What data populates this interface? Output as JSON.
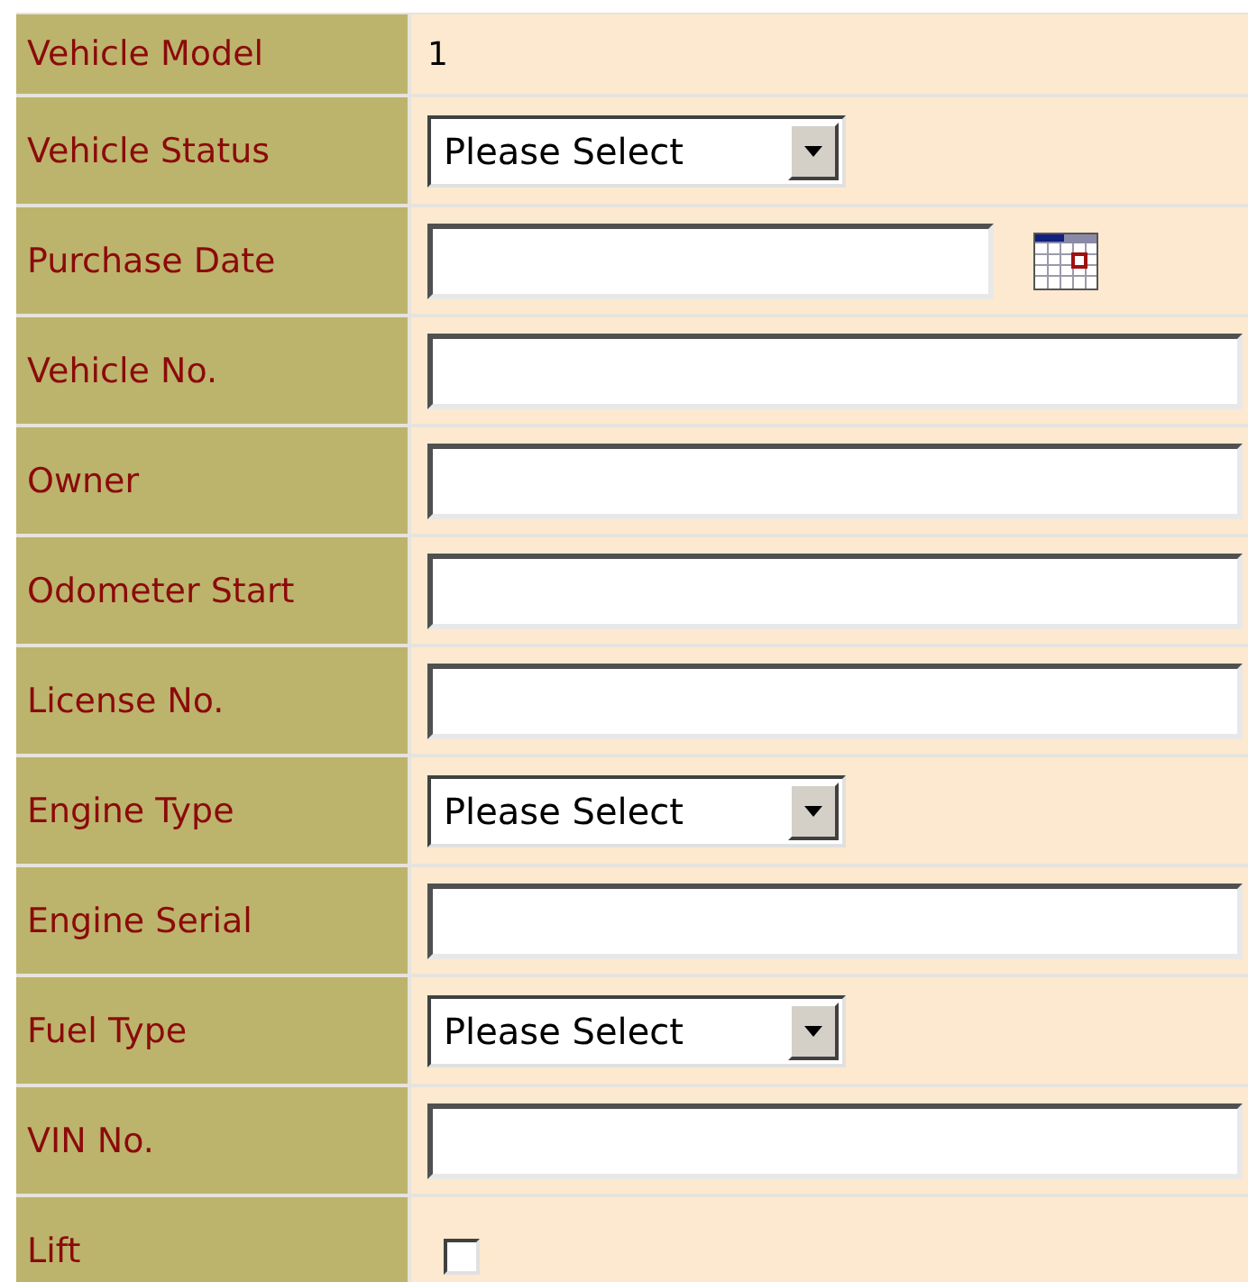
{
  "form": {
    "rows": [
      {
        "label": "Vehicle Model",
        "kind": "text",
        "value": "1"
      },
      {
        "label": "Vehicle Status",
        "kind": "select",
        "value": "Please Select"
      },
      {
        "label": "Purchase Date",
        "kind": "date"
      },
      {
        "label": "Vehicle No.",
        "kind": "input"
      },
      {
        "label": "Owner",
        "kind": "input"
      },
      {
        "label": "Odometer Start",
        "kind": "input"
      },
      {
        "label": "License No.",
        "kind": "input"
      },
      {
        "label": "Engine Type",
        "kind": "select",
        "value": "Please Select"
      },
      {
        "label": "Engine Serial",
        "kind": "input"
      },
      {
        "label": "Fuel Type",
        "kind": "select",
        "value": "Please Select"
      },
      {
        "label": "VIN No.",
        "kind": "input"
      },
      {
        "label": "Lift",
        "kind": "checkbox",
        "checked": false
      }
    ]
  }
}
